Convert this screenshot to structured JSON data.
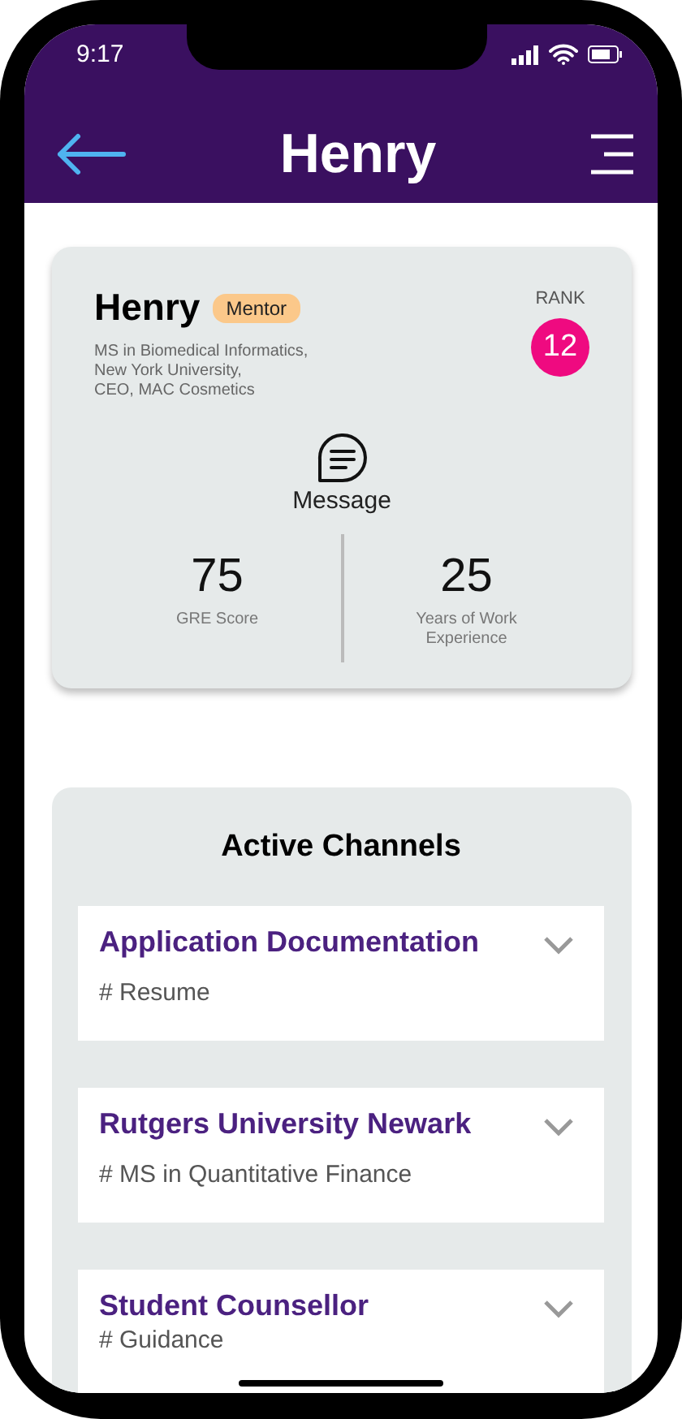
{
  "status_bar": {
    "time": "9:17"
  },
  "header": {
    "title": "Henry"
  },
  "profile": {
    "name": "Henry",
    "badge": "Mentor",
    "details": [
      "MS in Biomedical Informatics,",
      "New York University,",
      "CEO, MAC Cosmetics"
    ],
    "rank_label": "RANK",
    "rank": "12",
    "action": "Message",
    "stats": [
      {
        "value": "75",
        "label": "GRE Score"
      },
      {
        "value": "25",
        "label": "Years of Work Experience"
      }
    ]
  },
  "channels": {
    "title": "Active Channels",
    "items": [
      {
        "name": "Application Documentation",
        "tag": "# Resume",
        "expanded": false
      },
      {
        "name": "Rutgers University Newark",
        "tag": "# MS in Quantitative Finance",
        "expanded": false
      },
      {
        "name": "Student Counsellor",
        "tag": "# Guidance",
        "expanded": false
      }
    ]
  }
}
